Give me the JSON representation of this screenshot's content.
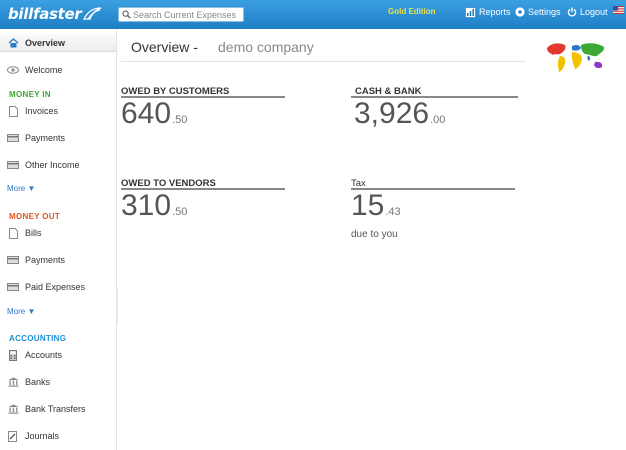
{
  "header": {
    "logo_text": "billfaster",
    "search_placeholder": "Search Current Expenses",
    "edition": "Gold Edition",
    "reports_label": "Reports",
    "settings_label": "Settings",
    "logout_label": "Logout"
  },
  "sidebar": {
    "overview": "Overview",
    "welcome": "Welcome",
    "money_in": {
      "heading": "MONEY IN",
      "items": [
        "Invoices",
        "Payments",
        "Other Income"
      ],
      "more": "More ▼"
    },
    "money_out": {
      "heading": "MONEY OUT",
      "items": [
        "Bills",
        "Payments",
        "Paid Expenses"
      ],
      "more": "More ▼"
    },
    "accounting": {
      "heading": "ACCOUNTING",
      "items": [
        "Accounts",
        "Banks",
        "Bank Transfers",
        "Journals"
      ]
    }
  },
  "main": {
    "title": "Overview -",
    "company": "demo company",
    "metrics": {
      "owed_by_customers": {
        "label": "OWED BY CUSTOMERS",
        "whole": "640",
        "cents": ".50"
      },
      "cash_bank": {
        "label": "CASH & BANK",
        "whole": "3,926",
        "cents": ".00"
      },
      "owed_to_vendors": {
        "label": "OWED TO VENDORS",
        "whole": "310",
        "cents": ".50"
      },
      "tax": {
        "label": "Tax",
        "whole": "15",
        "cents": ".43",
        "sub": "due to you"
      }
    }
  },
  "colors": {
    "header_blue": "#2a8ed4",
    "money_in": "#3aaa35",
    "money_out": "#e0541c",
    "accounting": "#1e8fd5",
    "edition": "#f2e24a",
    "link": "#2b7bc8"
  },
  "icons": {
    "overview": "home-icon",
    "welcome": "eye-icon",
    "invoices": "document-icon",
    "payments": "card-icon",
    "other_income": "card-icon",
    "bills": "document-icon",
    "paid_expenses": "card-icon",
    "accounts": "calculator-icon",
    "banks": "bank-icon",
    "bank_transfers": "bank-icon",
    "journals": "pencil-document-icon",
    "reports": "chart-icon",
    "settings": "gear-icon",
    "logout": "power-icon",
    "language": "us-flag-icon",
    "company_logo": "world-map-icon"
  }
}
